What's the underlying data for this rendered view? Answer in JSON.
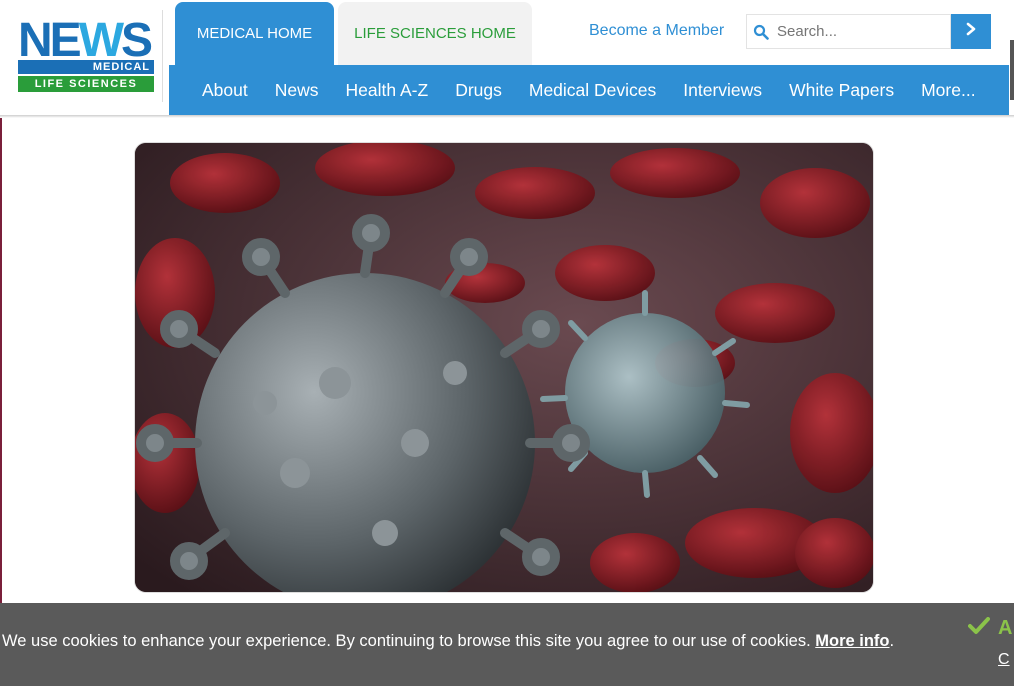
{
  "logo": {
    "word": "NEWS",
    "line1": "MEDICAL",
    "line2": "LIFE SCIENCES"
  },
  "tabs": [
    {
      "label": "MEDICAL HOME"
    },
    {
      "label": "LIFE SCIENCES HOME"
    }
  ],
  "member_link": "Become a Member",
  "search": {
    "placeholder": "Search...",
    "icon": "search-icon",
    "submit_icon": "chevron-right-icon"
  },
  "nav": [
    "About",
    "News",
    "Health A-Z",
    "Drugs",
    "Medical Devices",
    "Interviews",
    "White Papers",
    "More..."
  ],
  "hero": {
    "icon": "virus-illustration"
  },
  "cookie": {
    "message": "We use cookies to enhance your experience. By continuing to browse this site you agree to our use of cookies.",
    "link": "More info",
    "punct": ".",
    "accept": "A",
    "close": "C"
  },
  "colors": {
    "brand_blue": "#2f8fd4",
    "brand_green": "#2a9d3a",
    "cookie_bg": "#5a5a5a",
    "accept_green": "#8bc34a"
  }
}
